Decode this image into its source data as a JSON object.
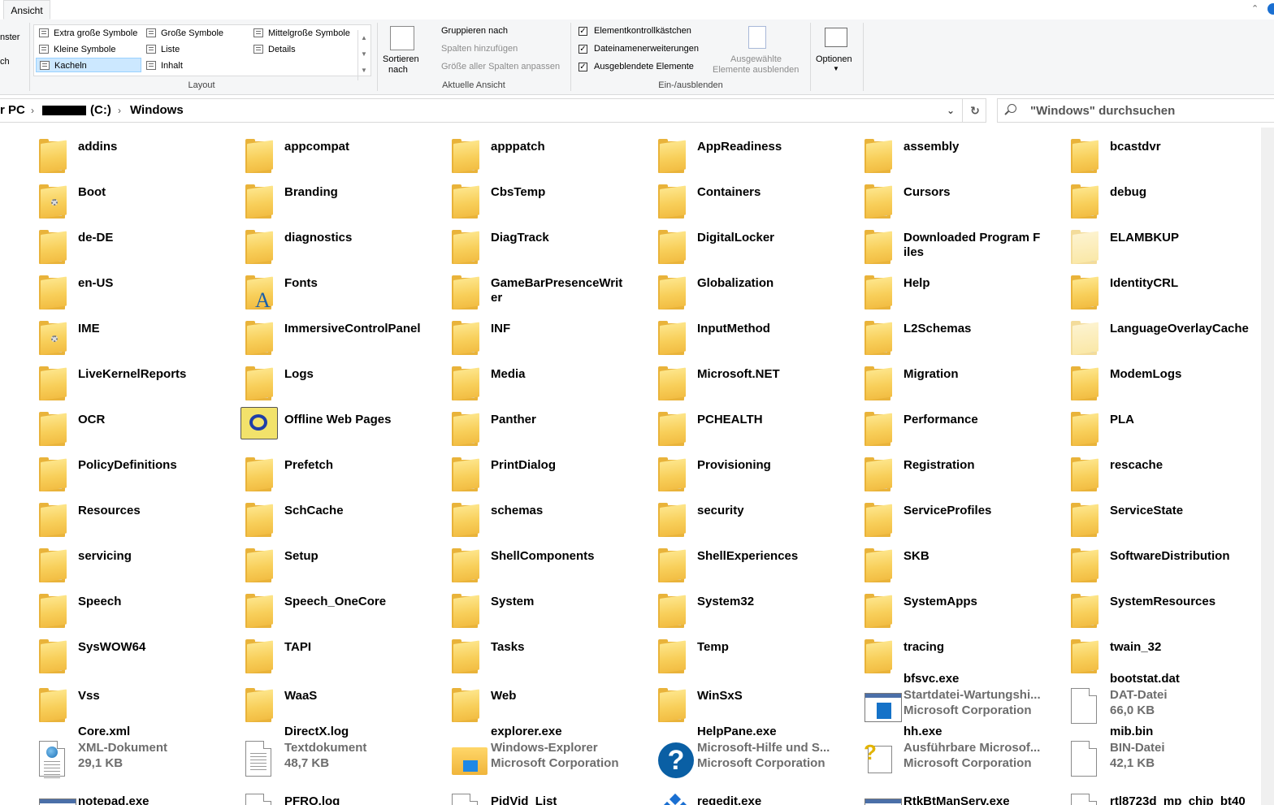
{
  "tabs": {
    "active_tab": "Ansicht"
  },
  "ribbon": {
    "left_cut_1": "nster",
    "left_cut_2": "ch",
    "layout": {
      "items": [
        "Extra große Symbole",
        "Große Symbole",
        "Mittelgroße Symbole",
        "Kleine Symbole",
        "Liste",
        "Details",
        "Kacheln",
        "Inhalt"
      ],
      "selected": "Kacheln",
      "caption": "Layout"
    },
    "current_view": {
      "sort_label_1": "Sortieren",
      "sort_label_2": "nach",
      "group_by": "Gruppieren nach",
      "add_columns": "Spalten hinzufügen",
      "fit_columns": "Größe aller Spalten anpassen",
      "caption": "Aktuelle Ansicht"
    },
    "show_hide": {
      "checkboxes": [
        {
          "label": "Elementkontrollkästchen",
          "checked": true
        },
        {
          "label": "Dateinamenerweiterungen",
          "checked": true
        },
        {
          "label": "Ausgeblendete Elemente",
          "checked": true
        }
      ],
      "hide_selected_1": "Ausgewählte",
      "hide_selected_2": "Elemente ausblenden",
      "caption": "Ein-/ausblenden"
    },
    "options": {
      "label": "Optionen"
    }
  },
  "address": {
    "crumb_pc": "r PC",
    "crumb_drive": "(C:)",
    "crumb_folder": "Windows"
  },
  "search": {
    "placeholder": "\"Windows\" durchsuchen"
  },
  "icons": {
    "folder": "folder-icon",
    "file": "file-icon",
    "exe": "application-icon",
    "help": "help-icon"
  },
  "items": [
    {
      "name": "addins",
      "kind": "folder-doc"
    },
    {
      "name": "appcompat",
      "kind": "folder"
    },
    {
      "name": "apppatch",
      "kind": "folder-doc"
    },
    {
      "name": "AppReadiness",
      "kind": "folder"
    },
    {
      "name": "assembly",
      "kind": "folder"
    },
    {
      "name": "bcastdvr",
      "kind": "folder-doc"
    },
    {
      "name": "Boot",
      "kind": "folder-gear"
    },
    {
      "name": "Branding",
      "kind": "folder"
    },
    {
      "name": "CbsTemp",
      "kind": "folder"
    },
    {
      "name": "Containers",
      "kind": "folder"
    },
    {
      "name": "Cursors",
      "kind": "folder-doc"
    },
    {
      "name": "debug",
      "kind": "folder-doc"
    },
    {
      "name": "de-DE",
      "kind": "folder-doc"
    },
    {
      "name": "diagnostics",
      "kind": "folder"
    },
    {
      "name": "DiagTrack",
      "kind": "folder-doc"
    },
    {
      "name": "DigitalLocker",
      "kind": "folder"
    },
    {
      "name": "Downloaded Program Files",
      "kind": "folder"
    },
    {
      "name": "ELAMBKUP",
      "kind": "folder-faded"
    },
    {
      "name": "en-US",
      "kind": "folder"
    },
    {
      "name": "Fonts",
      "kind": "folder-fonts"
    },
    {
      "name": "GameBarPresenceWriter",
      "kind": "folder"
    },
    {
      "name": "Globalization",
      "kind": "folder"
    },
    {
      "name": "Help",
      "kind": "folder"
    },
    {
      "name": "IdentityCRL",
      "kind": "folder-doc"
    },
    {
      "name": "IME",
      "kind": "folder-gear"
    },
    {
      "name": "ImmersiveControlPanel",
      "kind": "folder-doc"
    },
    {
      "name": "INF",
      "kind": "folder-doc"
    },
    {
      "name": "InputMethod",
      "kind": "folder"
    },
    {
      "name": "L2Schemas",
      "kind": "folder-doc"
    },
    {
      "name": "LanguageOverlayCache",
      "kind": "folder-faded"
    },
    {
      "name": "LiveKernelReports",
      "kind": "folder"
    },
    {
      "name": "Logs",
      "kind": "folder-doc"
    },
    {
      "name": "Media",
      "kind": "folder-doc"
    },
    {
      "name": "Microsoft.NET",
      "kind": "folder"
    },
    {
      "name": "Migration",
      "kind": "folder"
    },
    {
      "name": "ModemLogs",
      "kind": "folder"
    },
    {
      "name": "OCR",
      "kind": "folder"
    },
    {
      "name": "Offline Web Pages",
      "kind": "offline"
    },
    {
      "name": "Panther",
      "kind": "folder-doc"
    },
    {
      "name": "PCHEALTH",
      "kind": "folder"
    },
    {
      "name": "Performance",
      "kind": "folder"
    },
    {
      "name": "PLA",
      "kind": "folder"
    },
    {
      "name": "PolicyDefinitions",
      "kind": "folder-doc"
    },
    {
      "name": "Prefetch",
      "kind": "folder"
    },
    {
      "name": "PrintDialog",
      "kind": "folder-doc"
    },
    {
      "name": "Provisioning",
      "kind": "folder-doc"
    },
    {
      "name": "Registration",
      "kind": "folder-doc"
    },
    {
      "name": "rescache",
      "kind": "folder"
    },
    {
      "name": "Resources",
      "kind": "folder"
    },
    {
      "name": "SchCache",
      "kind": "folder"
    },
    {
      "name": "schemas",
      "kind": "folder"
    },
    {
      "name": "security",
      "kind": "folder"
    },
    {
      "name": "ServiceProfiles",
      "kind": "folder"
    },
    {
      "name": "ServiceState",
      "kind": "folder"
    },
    {
      "name": "servicing",
      "kind": "folder-doc"
    },
    {
      "name": "Setup",
      "kind": "folder"
    },
    {
      "name": "ShellComponents",
      "kind": "folder-doc"
    },
    {
      "name": "ShellExperiences",
      "kind": "folder-doc"
    },
    {
      "name": "SKB",
      "kind": "folder"
    },
    {
      "name": "SoftwareDistribution",
      "kind": "folder"
    },
    {
      "name": "Speech",
      "kind": "folder"
    },
    {
      "name": "Speech_OneCore",
      "kind": "folder"
    },
    {
      "name": "System",
      "kind": "folder"
    },
    {
      "name": "System32",
      "kind": "folder-doc"
    },
    {
      "name": "SystemApps",
      "kind": "folder"
    },
    {
      "name": "SystemResources",
      "kind": "folder-doc"
    },
    {
      "name": "SysWOW64",
      "kind": "folder-doc"
    },
    {
      "name": "TAPI",
      "kind": "folder"
    },
    {
      "name": "Tasks",
      "kind": "folder"
    },
    {
      "name": "Temp",
      "kind": "folder"
    },
    {
      "name": "tracing",
      "kind": "folder"
    },
    {
      "name": "twain_32",
      "kind": "folder-doc"
    },
    {
      "name": "Vss",
      "kind": "folder"
    },
    {
      "name": "WaaS",
      "kind": "folder"
    },
    {
      "name": "Web",
      "kind": "folder"
    },
    {
      "name": "WinSxS",
      "kind": "folder-doc"
    },
    {
      "name": "bfsvc.exe",
      "kind": "exe",
      "type": "Startdatei-Wartungshi...",
      "extra": "Microsoft Corporation"
    },
    {
      "name": "bootstat.dat",
      "kind": "file",
      "type": "DAT-Datei",
      "extra": "66,0 KB"
    },
    {
      "name": "Core.xml",
      "kind": "xml",
      "type": "XML-Dokument",
      "extra": "29,1 KB"
    },
    {
      "name": "DirectX.log",
      "kind": "txt",
      "type": "Textdokument",
      "extra": "48,7 KB"
    },
    {
      "name": "explorer.exe",
      "kind": "explorer",
      "type": "Windows-Explorer",
      "extra": "Microsoft Corporation"
    },
    {
      "name": "HelpPane.exe",
      "kind": "help",
      "type": "Microsoft-Hilfe und S...",
      "extra": "Microsoft Corporation"
    },
    {
      "name": "hh.exe",
      "kind": "hh",
      "type": "Ausführbare Microsof...",
      "extra": "Microsoft Corporation"
    },
    {
      "name": "mib.bin",
      "kind": "file",
      "type": "BIN-Datei",
      "extra": "42,1 KB"
    },
    {
      "name": "notepad.exe",
      "kind": "exe"
    },
    {
      "name": "PFRO.log",
      "kind": "txt"
    },
    {
      "name": "PidVid_List",
      "kind": "file"
    },
    {
      "name": "regedit.exe",
      "kind": "regedit"
    },
    {
      "name": "RtkBtManServ.exe",
      "kind": "exe"
    },
    {
      "name": "rtl8723d_mp_chip_bt40",
      "kind": "file"
    }
  ]
}
